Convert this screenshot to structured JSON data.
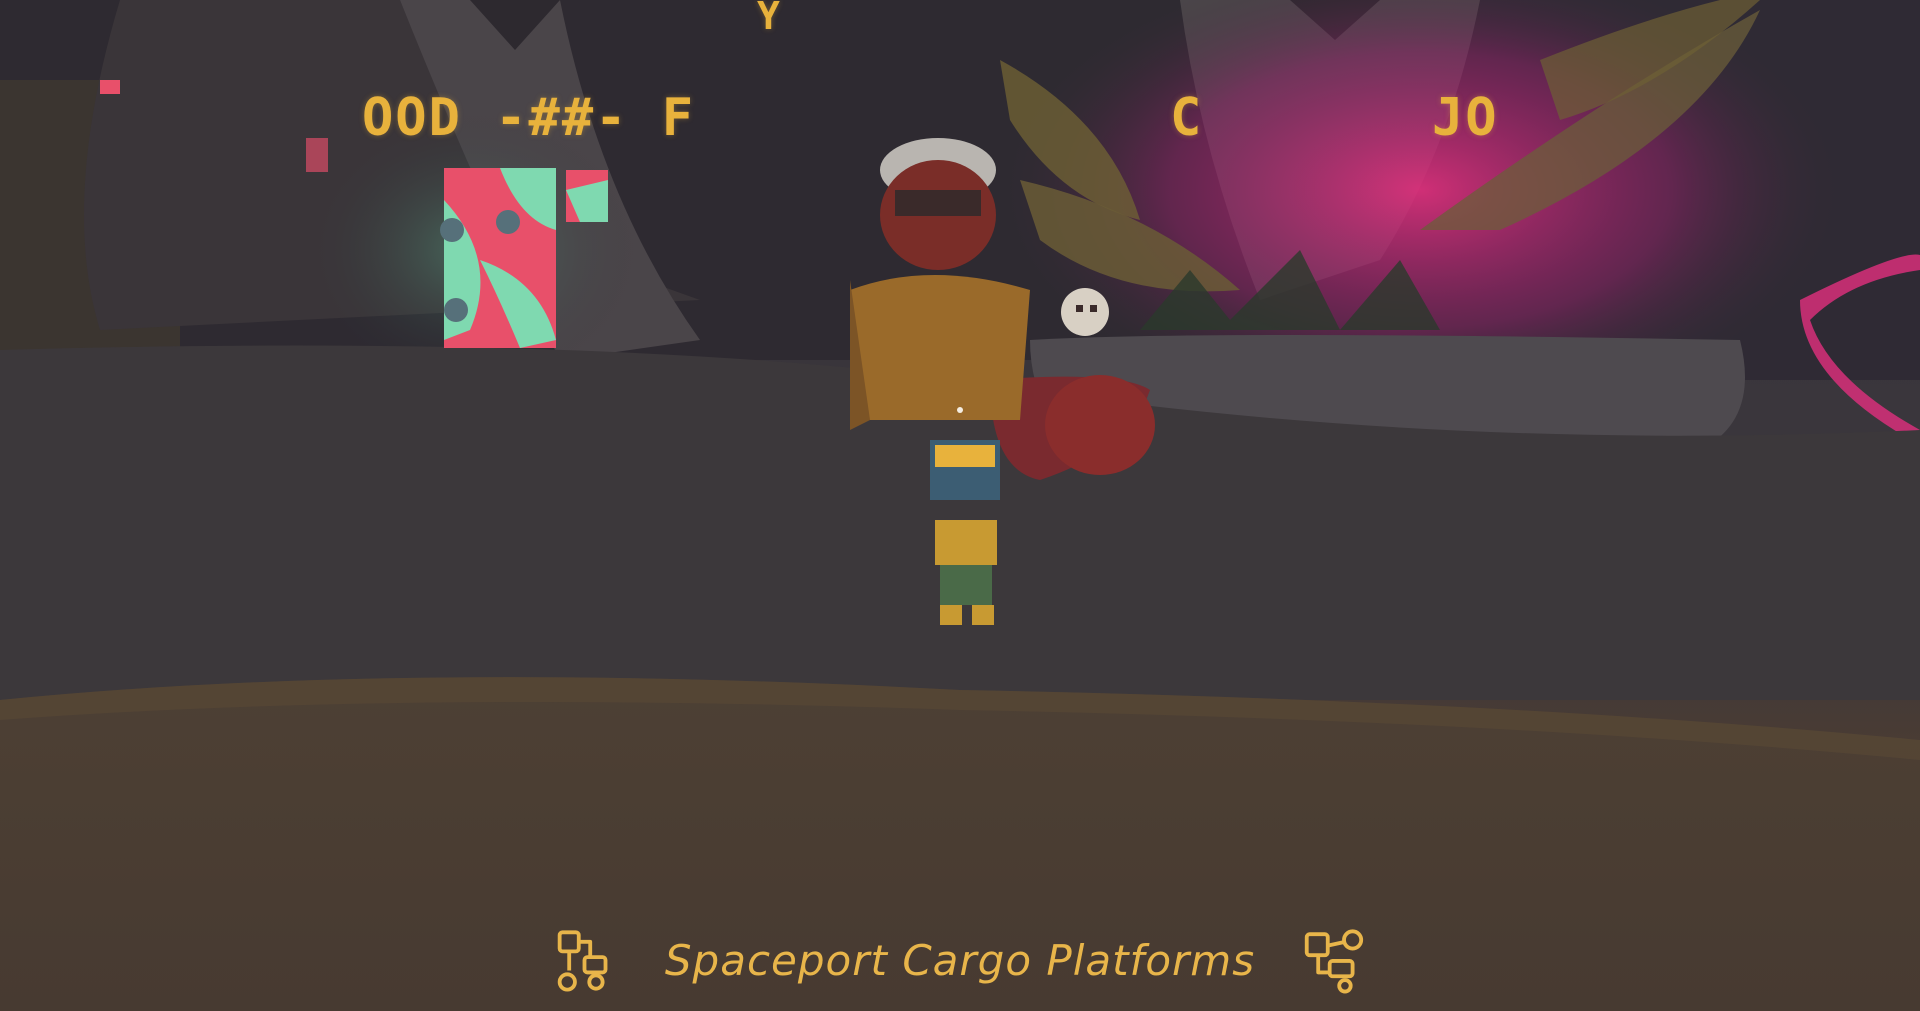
{
  "scene": {
    "signs": {
      "left": "OOD -##- F",
      "top": "Y",
      "right_a": "C",
      "right_b": "JO"
    }
  },
  "hud": {
    "location_name": "Spaceport Cargo Platforms",
    "left_icon": "path-nodes-icon",
    "right_icon": "path-nodes-icon",
    "accent_color": "#e8b54a"
  },
  "colors": {
    "text_accent": "#e8b54a",
    "neon_pink": "#e2307e",
    "poster_teal": "#7fd9b0",
    "poster_red": "#e8506a"
  }
}
